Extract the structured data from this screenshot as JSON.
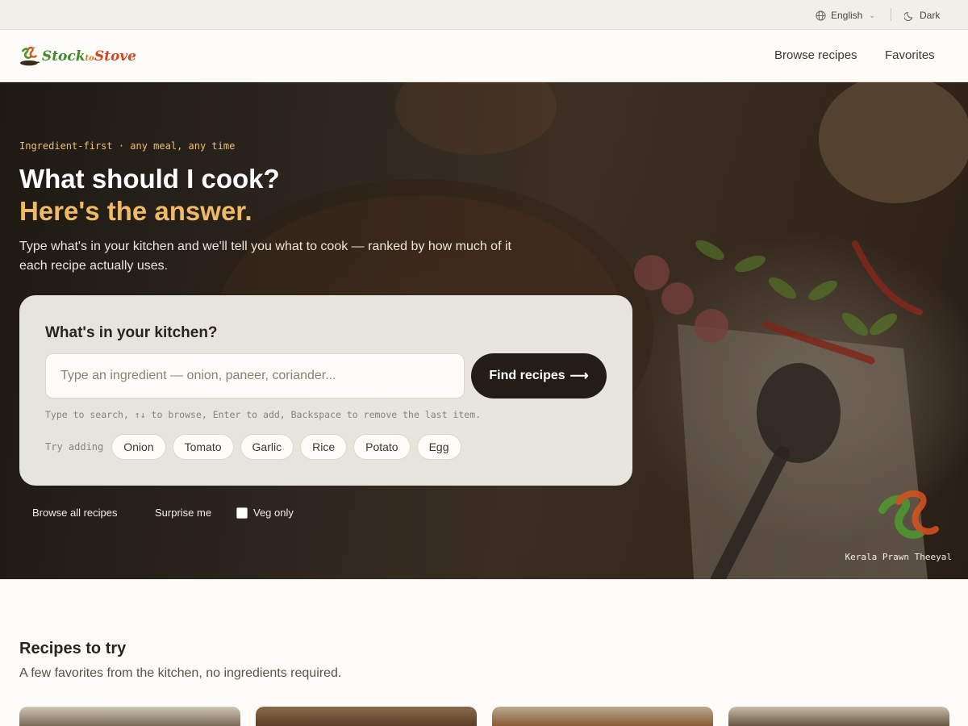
{
  "utility": {
    "language": "English",
    "theme_toggle": "Dark"
  },
  "header": {
    "logo_word1": "Stock",
    "logo_word2": "to",
    "logo_word3": "Stove",
    "nav": [
      "Browse recipes",
      "Favorites"
    ]
  },
  "hero": {
    "eyebrow": "Ingredient-first · any meal, any time",
    "title_line1": "What should I cook?",
    "title_line2": "Here's the answer.",
    "subtitle": "Type what's in your kitchen and we'll tell you what to cook — ranked by how much of it each recipe actually uses.",
    "card": {
      "title": "What's in your kitchen?",
      "input_placeholder": "Type an ingredient — onion, paneer, coriander...",
      "find_button": "Find recipes",
      "hint": "Type to search, ↑↓ to browse, Enter to add, Backspace to remove the last item.",
      "try_label": "Try adding",
      "chips": [
        "Onion",
        "Tomato",
        "Garlic",
        "Rice",
        "Potato",
        "Egg"
      ]
    },
    "links": {
      "browse_all": "Browse all recipes",
      "surprise": "Surprise me",
      "veg_only": "Veg only"
    },
    "caption": "Kerala Prawn Theeyal"
  },
  "recipes": {
    "title": "Recipes to try",
    "subtitle": "A few favorites from the kitchen, no ingredients required."
  },
  "colors": {
    "accent": "#f0b965",
    "eyebrow": "#f0c070",
    "button_dark": "#241d17",
    "page_bg": "#fdfcf8",
    "logo_green": "#3f8a2a",
    "logo_red": "#d4451e"
  }
}
